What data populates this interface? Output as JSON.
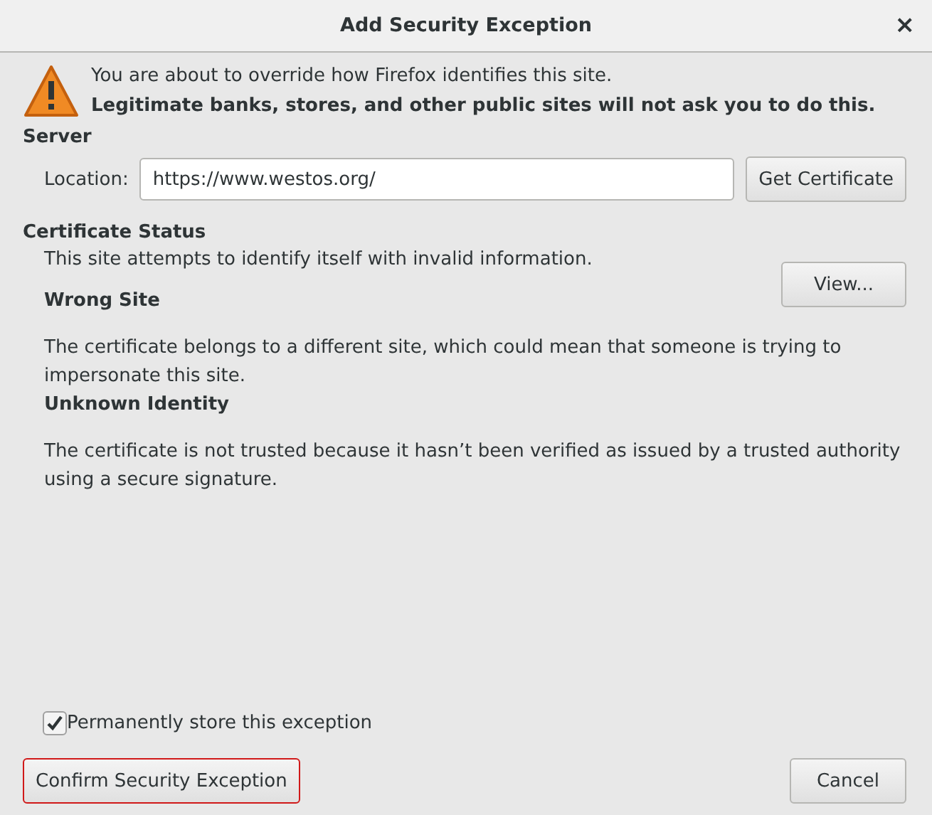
{
  "window": {
    "title": "Add Security Exception",
    "close": "×"
  },
  "warning": {
    "line1": "You are about to override how Firefox identifies this site.",
    "line2": "Legitimate banks, stores, and other public sites will not ask you to do this."
  },
  "server": {
    "heading": "Server",
    "location_label": "Location:",
    "location_value": "https://www.westos.org/",
    "button": "Get Certificate"
  },
  "status": {
    "heading": "Certificate Status",
    "summary": "This site attempts to identify itself with invalid information.",
    "button": "View...",
    "problems": [
      {
        "title": "Wrong Site",
        "text": "The certificate belongs to a different site, which could mean that someone is trying to impersonate this site."
      },
      {
        "title": "Unknown Identity",
        "text": "The certificate is not trusted because it hasn’t been verified as issued by a trusted authority using a secure signature."
      }
    ]
  },
  "permanent": {
    "label": "Permanently store this exception",
    "checked": true
  },
  "buttons": [
    {
      "label": "Confirm Security Exception",
      "selected": true
    },
    {
      "label": "Cancel",
      "selected": false
    }
  ]
}
